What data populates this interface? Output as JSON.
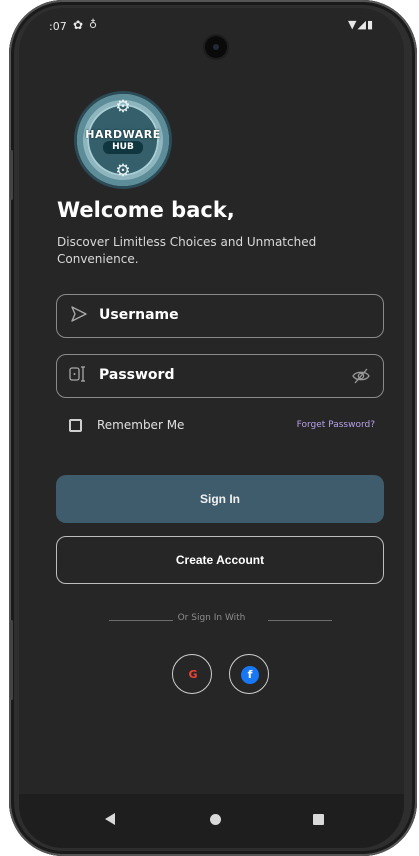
{
  "status_bar": {
    "time": ":07",
    "left_icons": [
      "gear-icon",
      "shield-icon"
    ],
    "right_icons": [
      "wifi-icon",
      "signal-icon",
      "battery-icon"
    ]
  },
  "logo": {
    "line1": "HARDWARE",
    "line2": "HUB"
  },
  "welcome": {
    "title": "Welcome back,",
    "subtitle": "Discover Limitless Choices and Unmatched Convenience."
  },
  "form": {
    "username": {
      "placeholder": "Username",
      "icon": "send-icon"
    },
    "password": {
      "placeholder": "Password",
      "icon": "password-icon",
      "toggle_icon": "eye-off-icon"
    },
    "remember_label": "Remember Me",
    "remember_checked": false,
    "forget_label": "Forget Password?"
  },
  "buttons": {
    "sign_in": "Sign In",
    "create_account": "Create Account"
  },
  "social": {
    "divider_label": "Or Sign In With",
    "providers": [
      "Google",
      "Facebook"
    ]
  },
  "navbar": {
    "icons": [
      "back-icon",
      "home-icon",
      "recents-icon"
    ]
  },
  "colors": {
    "background": "#262626",
    "primary_button": "#3f5c6c",
    "link": "#b6a2e8",
    "field_border": "#8a8a8a"
  }
}
